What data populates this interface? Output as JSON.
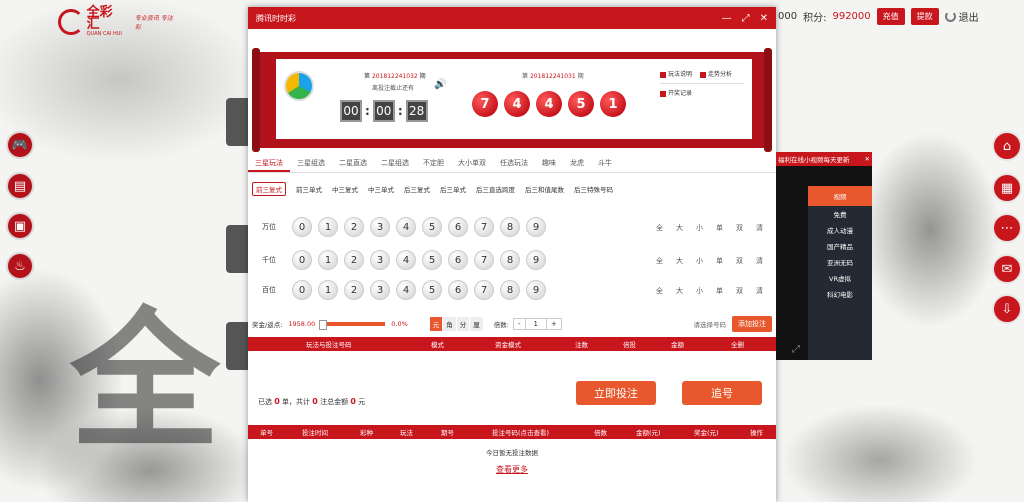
{
  "site": {
    "logo_text": "全彩汇",
    "logo_sub": "QUAN CAI HUI",
    "slogan": "专业资讯 专注彩",
    "bg_char": "全"
  },
  "top": {
    "partial_balance": "000",
    "points_label": "积分:",
    "points": "992000",
    "recharge": "充值",
    "withdraw": "提款",
    "logout": "退出"
  },
  "window": {
    "title": "腾讯时时彩",
    "controls": [
      "—",
      "⤢",
      "✕"
    ]
  },
  "draw": {
    "current_prefix": "第",
    "current_issue": "201812241032",
    "issue_suffix": "期",
    "deadline": "离投注截止还有",
    "timer": [
      "00",
      "00",
      "28"
    ],
    "prev_prefix": "第",
    "prev_issue": "201812241031",
    "prev_suffix": "期",
    "numbers": [
      "7",
      "4",
      "4",
      "5",
      "1"
    ]
  },
  "links": {
    "rules": "玩法说明",
    "trend": "走势分析",
    "records": "开奖记录"
  },
  "tabs": [
    "三星玩法",
    "三星组选",
    "二星直选",
    "二星组选",
    "不定胆",
    "大小单双",
    "任选玩法",
    "趣味",
    "龙虎",
    "斗牛"
  ],
  "subtabs": [
    "前三复式",
    "前三单式",
    "中三复式",
    "中三单式",
    "后三复式",
    "后三单式",
    "后三直选跨度",
    "后三和值尾数",
    "后三特殊号码"
  ],
  "rows": [
    {
      "label": "万位"
    },
    {
      "label": "千位"
    },
    {
      "label": "百位"
    }
  ],
  "digits": [
    "0",
    "1",
    "2",
    "3",
    "4",
    "5",
    "6",
    "7",
    "8",
    "9"
  ],
  "quick": [
    "全",
    "大",
    "小",
    "单",
    "双",
    "清"
  ],
  "bet": {
    "rebate_label": "奖金/返点:",
    "rebate_value": "1958.00",
    "percent": "0.0%",
    "units": [
      "元",
      "角",
      "分",
      "厘"
    ],
    "multiplier_label": "倍数:",
    "minus": "-",
    "mult": "1",
    "plus": "+",
    "hint": "请选择号码",
    "add": "添加投注"
  },
  "table1": {
    "cols": [
      "玩法与投注号码",
      "模式",
      "资金模式",
      "注数",
      "倍投",
      "金额",
      "全删"
    ]
  },
  "summary": {
    "prefix": "已选",
    "count": "0",
    "unit": "单，共计",
    "bets": "0",
    "bets_unit": "注总金额",
    "amount": "0",
    "currency": "元"
  },
  "buttons": {
    "bet_now": "立即投注",
    "chase": "追号"
  },
  "table2": {
    "cols": [
      "单号",
      "投注时间",
      "彩种",
      "玩法",
      "期号",
      "投注号码(点击查看)",
      "倍数",
      "金额(元)",
      "奖金(元)",
      "操作"
    ],
    "empty": "今日暂无投注数据",
    "more": "查看更多"
  },
  "video": {
    "ad": "福利在线小视频每天更新",
    "close": "✕",
    "menu_title": "视频",
    "items": [
      "免费",
      "成人动漫",
      "国产精品",
      "亚洲无码",
      "VR虚拟",
      "科幻电影"
    ]
  },
  "accent": "#c8161d",
  "orange": "#e8582c"
}
